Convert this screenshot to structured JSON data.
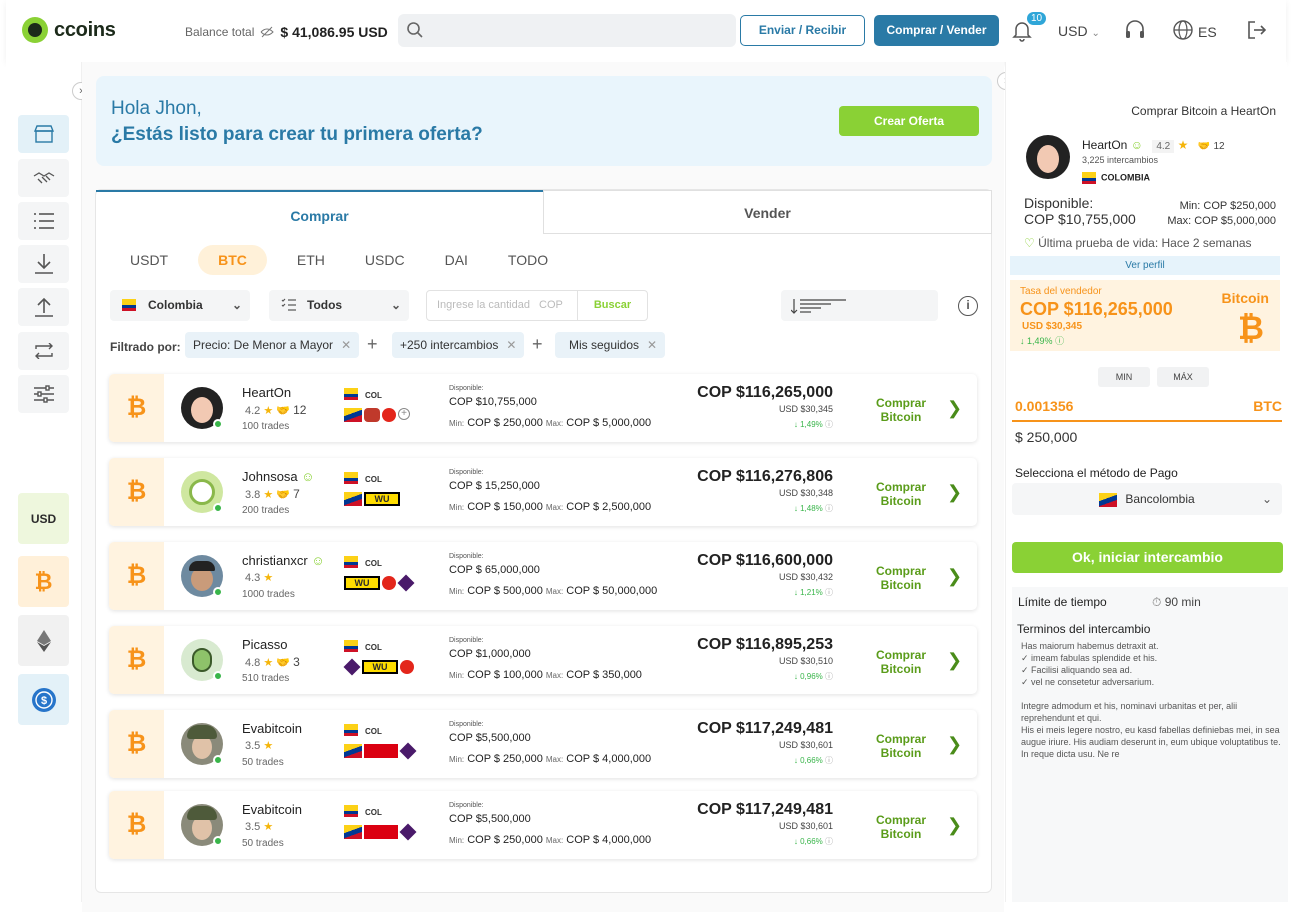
{
  "header": {
    "logo": "ccoins",
    "balance_label": "Balance total",
    "balance_value": "$ 41,086.95 USD",
    "send_receive": "Enviar / Recibir",
    "buy_sell": "Comprar / Vender",
    "notif_count": "10",
    "currency": "USD",
    "language": "ES"
  },
  "sidebar": {
    "coins": [
      "USD",
      "BTC",
      "ETH",
      "USDC"
    ]
  },
  "banner": {
    "greeting": "Hola Jhon,",
    "question": "¿Estás listo para crear tu primera oferta?",
    "cta": "Crear Oferta"
  },
  "tabs": {
    "buy": "Comprar",
    "sell": "Vender"
  },
  "coin_tabs": [
    "USDT",
    "BTC",
    "ETH",
    "USDC",
    "DAI",
    "TODO"
  ],
  "filters": {
    "country": "Colombia",
    "method": "Todos",
    "amount_placeholder": "Ingrese la cantidad",
    "amount_currency": "COP",
    "search": "Buscar",
    "filtered_by": "Filtrado por:",
    "chips": [
      "Precio: De Menor a Mayor",
      "+250 intercambios",
      "Mis seguidos"
    ]
  },
  "offers": [
    {
      "name": "HeartOn",
      "rating": "4.2",
      "trades_count": "12",
      "trades": "100 trades",
      "country": "COL",
      "disp_label": "Disponible:",
      "available": "COP $10,755,000",
      "min_label": "Min:",
      "min": "COP $ 250,000",
      "max_label": "Max:",
      "max": "COP $ 5,000,000",
      "price": "COP $116,265,000",
      "usd": "USD $30,345",
      "pct": "1,49%",
      "buy": "Comprar Bitcoin"
    },
    {
      "name": "Johnsosa",
      "rating": "3.8",
      "trades_count": "7",
      "trades": "200 trades",
      "country": "COL",
      "disp_label": "Disponible:",
      "available": "COP $ 15,250,000",
      "min_label": "Min:",
      "min": "COP $ 150,000",
      "max_label": "Max:",
      "max": "COP $ 2,500,000",
      "price": "COP $116,276,806",
      "usd": "USD $30,348",
      "pct": "1,48%",
      "buy": "Comprar Bitcoin"
    },
    {
      "name": "christianxcr",
      "rating": "4.3",
      "trades_count": "",
      "trades": "1000 trades",
      "country": "COL",
      "disp_label": "Disponible:",
      "available": "COP $ 65,000,000",
      "min_label": "Min:",
      "min": "COP $ 500,000",
      "max_label": "Max:",
      "max": "COP $ 50,000,000",
      "price": "COP $116,600,000",
      "usd": "USD $30,432",
      "pct": "1,21%",
      "buy": "Comprar Bitcoin"
    },
    {
      "name": "Picasso",
      "rating": "4.8",
      "trades_count": "3",
      "trades": "510 trades",
      "country": "COL",
      "disp_label": "Disponible:",
      "available": "COP $1,000,000",
      "min_label": "Min:",
      "min": "COP $ 100,000",
      "max_label": "Max:",
      "max": "COP $ 350,000",
      "price": "COP $116,895,253",
      "usd": "USD $30,510",
      "pct": "0,96%",
      "buy": "Comprar Bitcoin"
    },
    {
      "name": "Evabitcoin",
      "rating": "3.5",
      "trades_count": "",
      "trades": "50 trades",
      "country": "COL",
      "disp_label": "Disponible:",
      "available": "COP $5,500,000",
      "min_label": "Min:",
      "min": "COP $ 250,000",
      "max_label": "Max:",
      "max": "COP $ 4,000,000",
      "price": "COP $117,249,481",
      "usd": "USD $30,601",
      "pct": "0,66%",
      "buy": "Comprar Bitcoin"
    },
    {
      "name": "Evabitcoin",
      "rating": "3.5",
      "trades_count": "",
      "trades": "50 trades",
      "country": "COL",
      "disp_label": "Disponible:",
      "available": "COP $5,500,000",
      "min_label": "Min:",
      "min": "COP $ 250,000",
      "max_label": "Max:",
      "max": "COP $ 4,000,000",
      "price": "COP $117,249,481",
      "usd": "USD $30,601",
      "pct": "0,66%",
      "buy": "Comprar Bitcoin"
    }
  ],
  "right": {
    "title": "Comprar Bitcoin a HeartOn",
    "name": "HeartOn",
    "rating": "4.2",
    "trades_count": "12",
    "intercambios": "3,225 intercambios",
    "country": "COLOMBIA",
    "disp_label": "Disponible:",
    "disp_value": "COP $10,755,000",
    "min": "Min:  COP $250,000",
    "max": "Max: COP $5,000,000",
    "life": "Última prueba de vida: Hace 2 semanas",
    "ver_perfil": "Ver perfil",
    "rate_label": "Tasa del vendedor",
    "rate": "COP $116,265,000",
    "rate_usd": "USD $30,345",
    "rate_pct": "1,49%",
    "rate_coin": "Bitcoin",
    "min_btn": "MIN",
    "max_btn": "MÁX",
    "btc_amount": "0.001356",
    "btc_unit": "BTC",
    "cop_amount": "$ 250,000",
    "method_label": "Selecciona el método de Pago",
    "method": "Bancolombia",
    "ok": "Ok, iniciar intercambio",
    "time_label": "Límite de tiempo",
    "time_value": "90 min",
    "terms_title": "Terminos del intercambio",
    "terms_text": "Has maiorum habemus detraxit at.\n✓ imeam fabulas splendide et his.\n✓ Facilisi aliquando sea ad.\n✓ vel ne consetetur adversarium.\n\nIntegre admodum et his, nominavi urbanitas et per, alii reprehendunt et qui.\nHis ei meis legere nostro, eu kasd fabellas definiebas mei, in sea augue iriure. His audiam deserunt in, eum ubique voluptatibus te. In reque dicta usu. Ne re"
  }
}
